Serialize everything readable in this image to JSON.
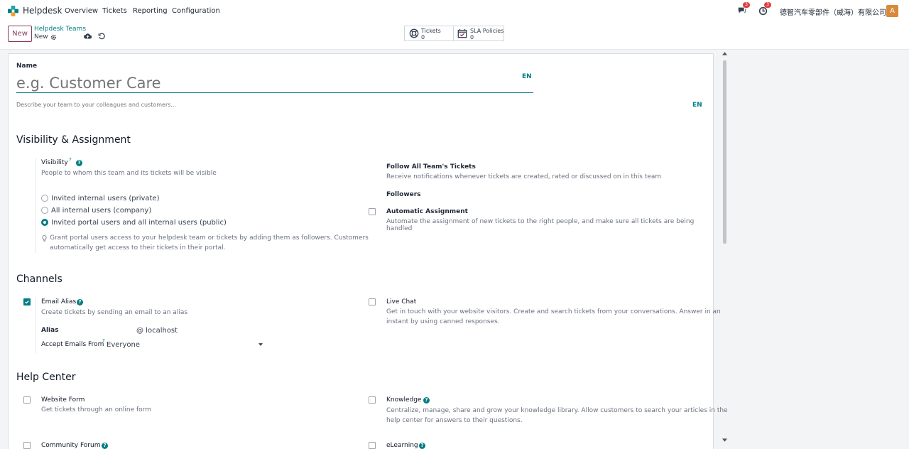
{
  "navbar": {
    "app_name": "Helpdesk",
    "menu": [
      "Overview",
      "Tickets",
      "Reporting",
      "Configuration"
    ],
    "messages_count": "3",
    "activities_count": "3",
    "company": "德智汽车零部件（威海）有限公司",
    "avatar_letter": "A"
  },
  "control_panel": {
    "new_label": "New",
    "breadcrumb_parent": "Helpdesk Teams",
    "breadcrumb_current": "New",
    "stats": [
      {
        "label": "Tickets",
        "value": "0"
      },
      {
        "label": "SLA Policies",
        "value": "0"
      }
    ]
  },
  "form": {
    "name_label": "Name",
    "name_placeholder": "e.g. Customer Care",
    "lang": "EN",
    "description_placeholder": "Describe your team to your colleagues and customers...",
    "visibility_section": "Visibility & Assignment",
    "visibility_label": "Visibility",
    "visibility_help": "People to whom this team and its tickets will be visible",
    "visibility_options": [
      "Invited internal users (private)",
      "All internal users (company)",
      "Invited portal users and all internal users (public)"
    ],
    "visibility_selected": 2,
    "visibility_hint_line1": "Grant portal users access to your helpdesk team or tickets by adding them as followers. Customers",
    "visibility_hint_line2": "automatically get access to their tickets in their portal.",
    "follow_label": "Follow All Team's Tickets",
    "follow_help": "Receive notifications whenever tickets are created, rated or discussed on in this team",
    "followers_label": "Followers",
    "auto_assign_label": "Automatic Assignment",
    "auto_assign_help": "Automate the assignment of new tickets to the right people, and make sure all tickets are being handled",
    "channels_section": "Channels",
    "email_alias_label": "Email Alias",
    "email_alias_help": "Create tickets by sending an email to an alias",
    "alias_label": "Alias",
    "alias_domain": "@ localhost",
    "accept_from_label": "Accept Emails From",
    "accept_from_value": "Everyone",
    "live_chat_label": "Live Chat",
    "live_chat_help_1": "Get in touch with your website visitors. Create and search tickets from your conversations. Answer in an",
    "live_chat_help_2": "instant by using canned responses.",
    "help_center_section": "Help Center",
    "website_form_label": "Website Form",
    "website_form_help": "Get tickets through an online form",
    "knowledge_label": "Knowledge",
    "knowledge_help_1": "Centralize, manage, share and grow your knowledge library. Allow customers to search your articles in the",
    "knowledge_help_2": "help center for answers to their questions.",
    "forum_label": "Community Forum",
    "elearning_label": "eLearning"
  },
  "colors": {
    "accent": "#017e84",
    "brand": "#8a3a5c",
    "badge": "#e03f3f"
  }
}
